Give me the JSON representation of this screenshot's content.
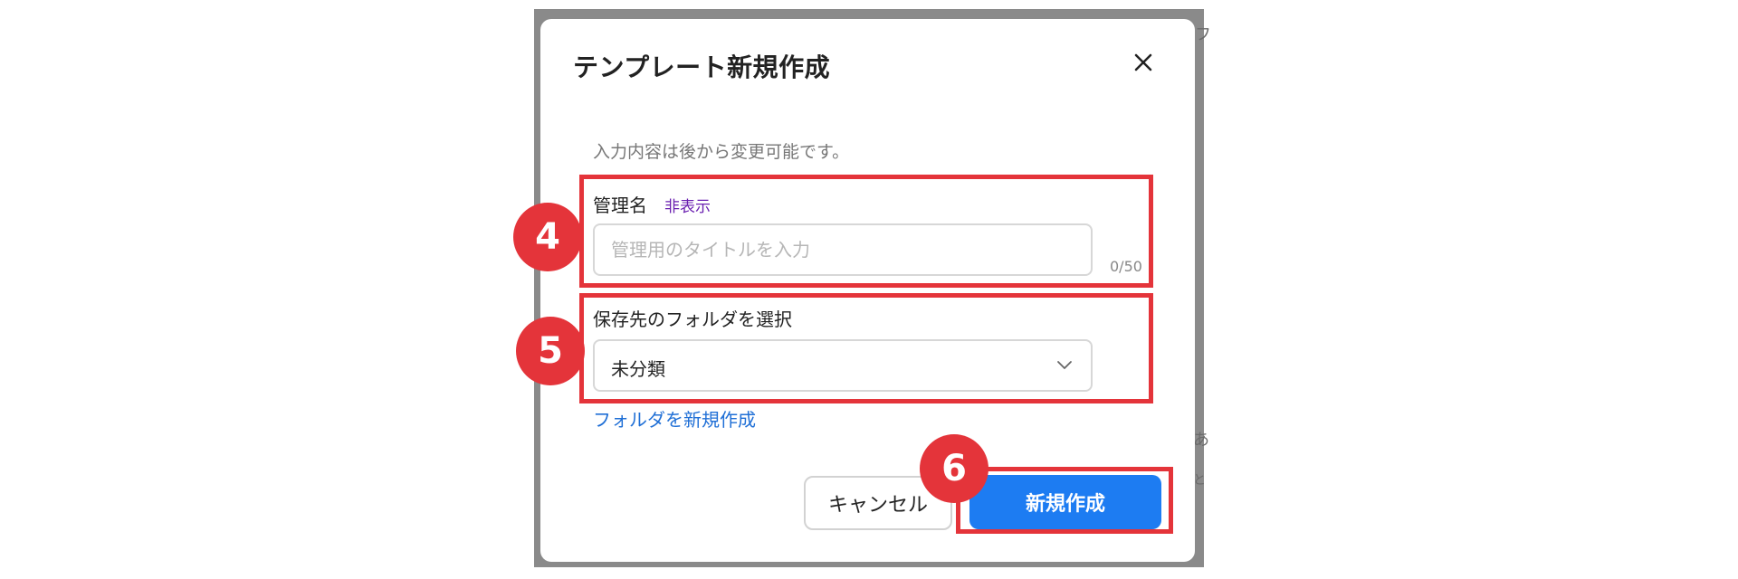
{
  "dialog": {
    "title": "テンプレート新規作成",
    "hint": "入力内容は後から変更可能です。"
  },
  "name_field": {
    "label": "管理名",
    "toggle_label": "非表示",
    "placeholder": "管理用のタイトルを入力",
    "value": "",
    "counter": "0/50"
  },
  "folder_field": {
    "label": "保存先のフォルダを選択",
    "selected": "未分類",
    "create_link": "フォルダを新規作成"
  },
  "buttons": {
    "cancel": "キャンセル",
    "create": "新規作成"
  },
  "steps": [
    "4",
    "5",
    "6"
  ],
  "background": {
    "partial_glyphs": [
      "フ",
      "あ",
      "と"
    ]
  },
  "colors": {
    "primary": "#1d7cf2",
    "highlight": "#e4343a",
    "link": "#1f6fd6",
    "toggle": "#6a1fb0"
  }
}
